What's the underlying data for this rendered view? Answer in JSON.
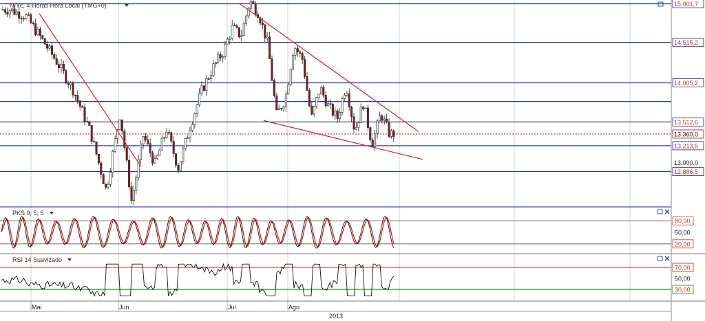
{
  "header": {
    "title": "NIYc, 4 Horas Hora Local (TMG+0)"
  },
  "colors": {
    "candle_up": "#ffffff",
    "candle_down": "#8b1c1c",
    "candle_wick": "#222222",
    "hline": "#0a1e9a",
    "trend": "#d92020",
    "current": "#b01010",
    "grid": "#c8c8c8",
    "stoch_k": "#111111",
    "stoch_d": "#d02020",
    "rsi_line": "#111111",
    "rsi_upper": "#c0201f",
    "rsi_lower": "#1a8a1a",
    "stoch_band": "#c84040"
  },
  "chart_data": [
    {
      "type": "candlestick",
      "title": "NIYc, 4 Horas Hora Local (TMG+0)",
      "x_axis": {
        "labels": [
          "Mai",
          "Jun",
          "Jul",
          "Ago"
        ],
        "year_label": "2013"
      },
      "y_axis": {
        "ylim": [
          12450,
          15050
        ],
        "tick_labels": [
          "15.001,7",
          "14.515,2",
          "14.005,2",
          "13.512,6",
          "13.360,0",
          "13.213,5",
          "13.000,0",
          "12.886,5"
        ]
      },
      "horizontal_lines": [
        15001.7,
        14515.2,
        14005.2,
        13770,
        13512.6,
        13213.5,
        12886.5
      ],
      "current_price": 13360.0,
      "key_points": [
        {
          "date": "Mai",
          "value": 14930
        },
        {
          "date": "Mai",
          "value": 14850
        },
        {
          "date": "Mai",
          "value": 14560
        },
        {
          "date": "Mai",
          "value": 14250
        },
        {
          "date": "Mai",
          "value": 13900
        },
        {
          "date": "Mai",
          "value": 13400
        },
        {
          "date": "Mai",
          "value": 12650
        },
        {
          "date": "Jun",
          "value": 13620
        },
        {
          "date": "Jun",
          "value": 12500
        },
        {
          "date": "Jun",
          "value": 13350
        },
        {
          "date": "Jun",
          "value": 12980
        },
        {
          "date": "Jun",
          "value": 13420
        },
        {
          "date": "Jun",
          "value": 12930
        },
        {
          "date": "Jun",
          "value": 13450
        },
        {
          "date": "Jun",
          "value": 13900
        },
        {
          "date": "Jun",
          "value": 14200
        },
        {
          "date": "Jul",
          "value": 14400
        },
        {
          "date": "Jul",
          "value": 14700
        },
        {
          "date": "Jul",
          "value": 14600
        },
        {
          "date": "Jul",
          "value": 15040
        },
        {
          "date": "Jul",
          "value": 14880
        },
        {
          "date": "Jul",
          "value": 14500
        },
        {
          "date": "Jul",
          "value": 13600
        },
        {
          "date": "Ago",
          "value": 13800
        },
        {
          "date": "Ago",
          "value": 14480
        },
        {
          "date": "Ago",
          "value": 14300
        },
        {
          "date": "Ago",
          "value": 13550
        },
        {
          "date": "Ago",
          "value": 13950
        },
        {
          "date": "Ago",
          "value": 13700
        },
        {
          "date": "Ago",
          "value": 13560
        },
        {
          "date": "Ago",
          "value": 13980
        },
        {
          "date": "Ago",
          "value": 13400
        },
        {
          "date": "Ago",
          "value": 13750
        },
        {
          "date": "Ago",
          "value": 13230
        },
        {
          "date": "Ago",
          "value": 13620
        },
        {
          "date": "Ago",
          "value": 13360
        }
      ],
      "trendlines": [
        {
          "name": "",
          "from": {
            "date": "Mai",
            "value": 14880
          },
          "to": {
            "date": "Jun",
            "value": 12950
          }
        },
        {
          "name": "",
          "from": {
            "date": "Jul",
            "value": 15010
          },
          "to": {
            "date": "Ago",
            "value": 13390
          }
        },
        {
          "name": "",
          "from": {
            "date": "Jul",
            "value": 13530
          },
          "to": {
            "date": "Ago",
            "value": 13040
          }
        }
      ]
    },
    {
      "type": "line",
      "title": "PKS 9; 5; 5",
      "ylim": [
        0,
        100
      ],
      "tick_labels": [
        "80,00",
        "50,00",
        "20,00"
      ],
      "bands": [
        80,
        20
      ]
    },
    {
      "type": "line",
      "title": "RSI 14 Suavizado",
      "ylim": [
        10,
        90
      ],
      "tick_labels": [
        "70,00",
        "50,00",
        "30,00"
      ],
      "bands": [
        70,
        30
      ]
    }
  ]
}
